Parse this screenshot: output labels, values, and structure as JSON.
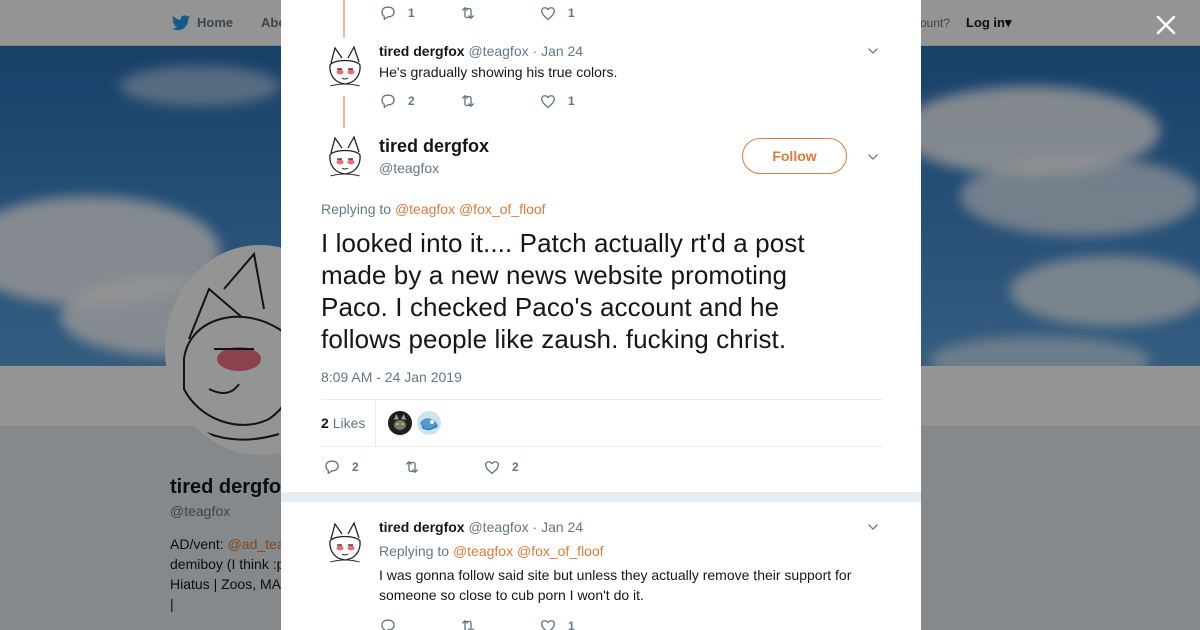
{
  "topbar": {
    "home_label": "Home",
    "about_label": "Abo",
    "account_prompt": "ccount?",
    "login_label": "Log in"
  },
  "profile": {
    "name": "tired dergfox",
    "handle": "@teagfox",
    "bio_prefix": "AD/vent:",
    "bio_link": "@ad_tea",
    "bio_line2": "demiboy (I think :p",
    "bio_line3": "Hiatus | Zoos, MA",
    "bio_line4": "|"
  },
  "tweet_prev_actions": {
    "replies": "1",
    "likes": "1"
  },
  "tweet2": {
    "name": "tired dergfox",
    "handle": "@teagfox",
    "separator": "·",
    "date": "Jan 24",
    "text": "He's gradually showing his true colors.",
    "replies": "2",
    "likes": "1"
  },
  "main_tweet": {
    "name": "tired dergfox",
    "handle": "@teagfox",
    "follow_label": "Follow",
    "replying_to": "Replying to",
    "mention1": "@teagfox",
    "mention2": "@fox_of_floof",
    "text": "I looked into it.... Patch actually rt'd a post made by a new news website promoting Paco. I checked Paco's account and he follows people like zaush. fucking christ.",
    "timestamp": "8:09 AM - 24 Jan 2019",
    "likes_count": "2",
    "likes_label": "Likes",
    "replies": "2",
    "likes": "2"
  },
  "reply_tweet": {
    "name": "tired dergfox",
    "handle": "@teagfox",
    "separator": "·",
    "date": "Jan 24",
    "replying_to": "Replying to",
    "mention1": "@teagfox",
    "mention2": "@fox_of_floof",
    "text": "I was gonna follow said site but unless they actually remove their support for someone so close to cub porn I won't do it.",
    "likes": "1"
  },
  "colors": {
    "accent": "#e07a3a",
    "muted": "#657786",
    "text": "#14171a",
    "twitter_blue": "#1da1f2",
    "blush": "#e8435b"
  }
}
